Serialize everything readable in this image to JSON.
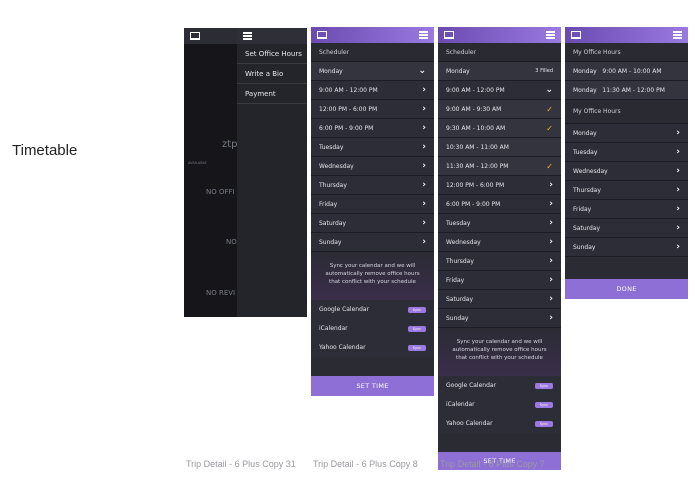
{
  "page_title": "Timetable",
  "screen1": {
    "menu_items": [
      "Set Office Hours",
      "Write a Bio",
      "Payment"
    ],
    "ghost_texts": [
      "ztp",
      "NO OFFI",
      "NO",
      "NO REVI",
      "AVAILABLE"
    ]
  },
  "screen2": {
    "header": "Scheduler",
    "day_selected": "Monday",
    "slots": [
      "9:00 AM - 12:00 PM",
      "12:00 PM - 6:00 PM",
      "6:00 PM - 9:00 PM"
    ],
    "days": [
      "Tuesday",
      "Wednesday",
      "Thursday",
      "Friday",
      "Saturday",
      "Sunday"
    ],
    "sync_text": "Sync your calendar and we will automatically remove office hours that conflict with your schedule",
    "calendars": [
      "Google Calendar",
      "iCalendar",
      "Yahoo Calendar"
    ],
    "sync_label": "Sync",
    "cta": "SET TIME"
  },
  "screen3": {
    "header": "Scheduler",
    "day_selected": "Monday",
    "filled": "3 Filled",
    "slot_open": "9:00 AM - 12:00 PM",
    "sub_slots": [
      "9:00 AM - 9:30 AM",
      "9:30 AM - 10:00 AM",
      "10:30 AM - 11:00 AM",
      "11:30 AM - 12:00 PM"
    ],
    "slots": [
      "12:00 PM - 6:00 PM",
      "6:00 PM - 9:00 PM"
    ],
    "days": [
      "Tuesday",
      "Wednesday",
      "Thursday",
      "Friday",
      "Saturday",
      "Sunday"
    ],
    "sync_text": "Sync your calendar and we will automatically remove office hours that conflict with your schedule",
    "calendars": [
      "Google Calendar",
      "iCalendar",
      "Yahoo Calendar"
    ],
    "sync_label": "Sync",
    "cta": "SET TIME"
  },
  "screen4": {
    "header": "My Office Hours",
    "hours": [
      {
        "day": "Monday",
        "time": "9:00 AM - 10:00 AM"
      },
      {
        "day": "Monday",
        "time": "11:30 AM - 12:00 PM"
      }
    ],
    "section": "My Office Hours",
    "days": [
      "Monday",
      "Tuesday",
      "Wednesday",
      "Thursday",
      "Friday",
      "Saturday",
      "Sunday"
    ],
    "cta": "DONE"
  },
  "captions": [
    "Trip Detail - 6 Plus Copy 31",
    "Trip Detail - 6 Plus Copy 8",
    "Trip Detail - 6 Plus Copy 7"
  ]
}
